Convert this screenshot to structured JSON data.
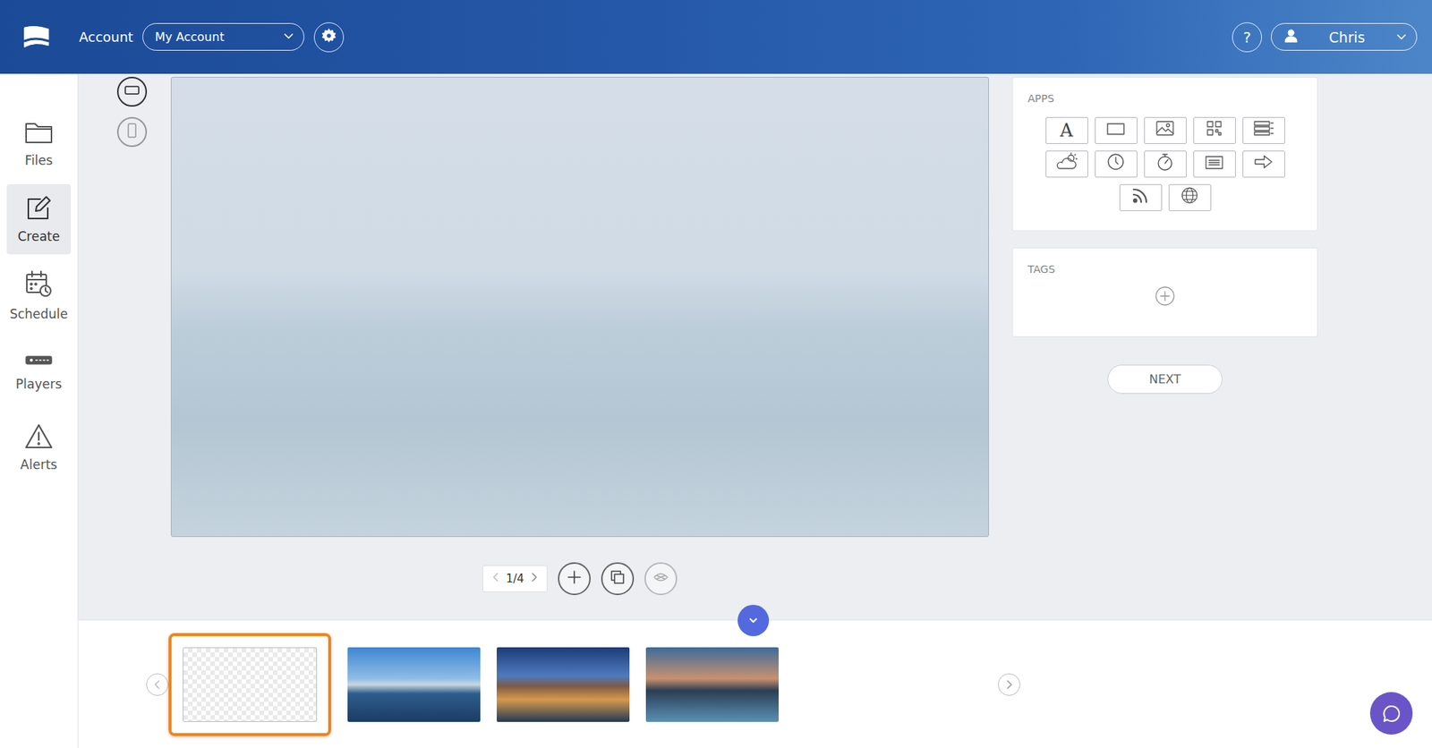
{
  "header": {
    "account_label": "Account",
    "account_select": {
      "value": "My Account"
    },
    "help": "?",
    "user": {
      "name": "Chris"
    }
  },
  "sidebar": {
    "items": [
      {
        "label": "Files",
        "kind": "files",
        "selected": false
      },
      {
        "label": "Create",
        "kind": "create",
        "selected": true
      },
      {
        "label": "Schedule",
        "kind": "schedule",
        "selected": false
      },
      {
        "label": "Players",
        "kind": "players",
        "selected": false
      },
      {
        "label": "Alerts",
        "kind": "alerts",
        "selected": false
      }
    ]
  },
  "orientation": [
    {
      "kind": "landscape",
      "selected": true
    },
    {
      "kind": "portrait",
      "selected": false
    }
  ],
  "apps": {
    "title": "APPS",
    "items": [
      {
        "kind": "text",
        "glyph": "A"
      },
      {
        "kind": "shape"
      },
      {
        "kind": "image"
      },
      {
        "kind": "qr"
      },
      {
        "kind": "table"
      },
      {
        "kind": "weather"
      },
      {
        "kind": "clock"
      },
      {
        "kind": "timer"
      },
      {
        "kind": "ticker"
      },
      {
        "kind": "arrow"
      },
      {
        "kind": "rss"
      },
      {
        "kind": "web"
      }
    ]
  },
  "tags": {
    "title": "TAGS"
  },
  "next_button": "NEXT",
  "pager": {
    "page": "1/4",
    "buttons": [
      {
        "kind": "add",
        "disabled": false
      },
      {
        "kind": "duplicate",
        "disabled": false
      },
      {
        "kind": "unlink",
        "disabled": true
      }
    ]
  },
  "slides": [
    {
      "kind": "blank",
      "selected": true
    },
    {
      "kind": "photo",
      "selected": false
    },
    {
      "kind": "photo",
      "selected": false
    },
    {
      "kind": "photo",
      "selected": false
    }
  ]
}
